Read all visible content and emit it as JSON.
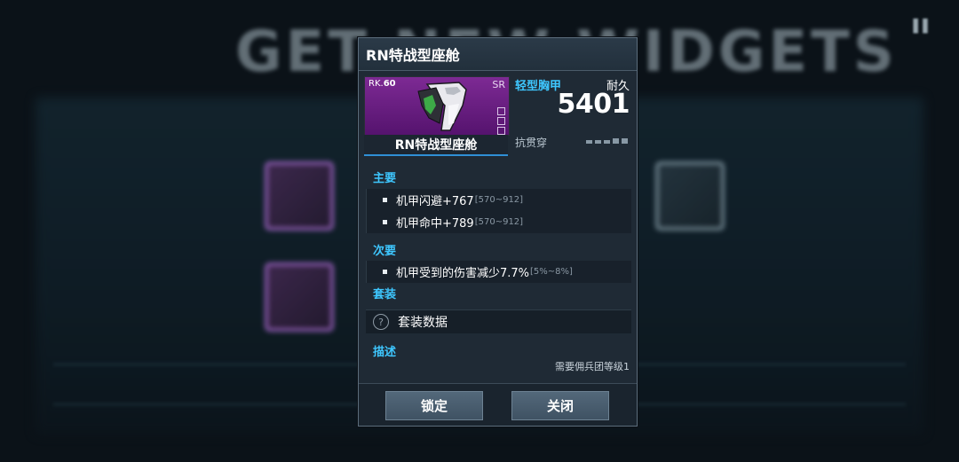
{
  "background": {
    "title": "GET NEW WIDGETS",
    "corner": "▌▌"
  },
  "dialog": {
    "title": "RN特战型座舱",
    "item": {
      "rank_prefix": "RK.",
      "rank": "60",
      "grade": "SR",
      "name": "RN特战型座舱",
      "type": "轻型胸甲",
      "durability_label": "耐久",
      "durability_value": "5401",
      "pierce_label": "抗贯穿",
      "pierce_level": 0,
      "card_color": "#7d2a94"
    },
    "primary": {
      "heading": "主要",
      "stats": [
        {
          "text": "机甲闪避+767",
          "range": "[570~912]"
        },
        {
          "text": "机甲命中+789",
          "range": "[570~912]"
        }
      ]
    },
    "secondary": {
      "heading": "次要",
      "stats": [
        {
          "text": "机甲受到的伤害减少7.7%",
          "range": "[5%~8%]"
        }
      ]
    },
    "set": {
      "heading": "套装",
      "icon": "question-icon",
      "label": "套装数据"
    },
    "description": {
      "heading": "描述",
      "requirement": "需要佣兵团等级1"
    },
    "buttons": {
      "lock": "锁定",
      "close": "关闭"
    }
  }
}
